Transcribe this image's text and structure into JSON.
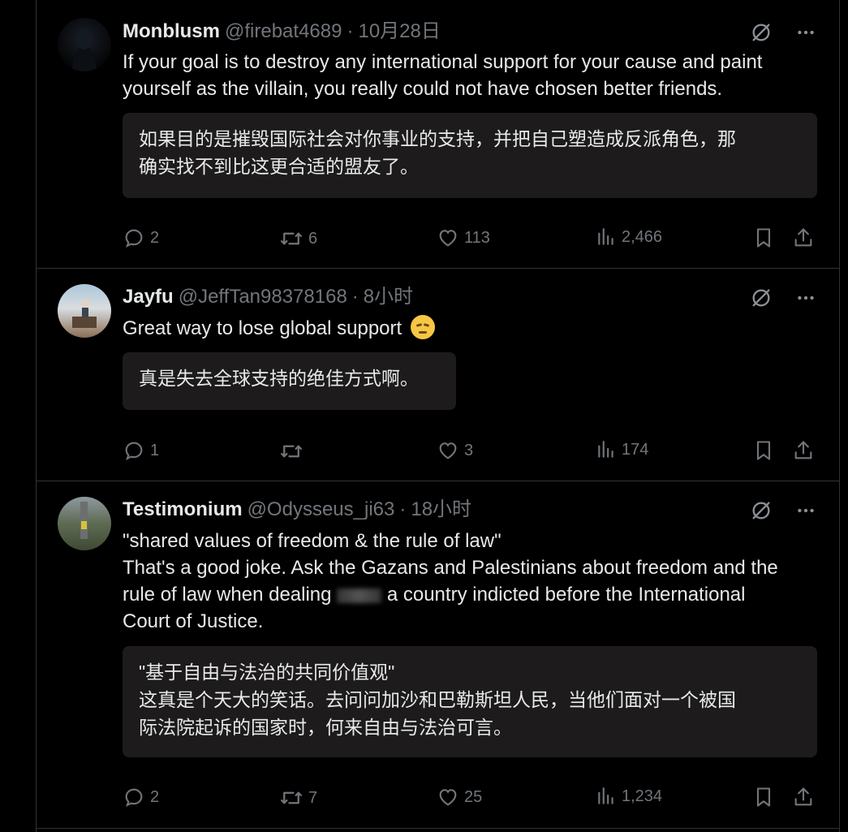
{
  "tweets": [
    {
      "name": "Monblusm",
      "handle": "@firebat4689",
      "time": "10月28日",
      "lines": [
        "If your goal is to destroy any international support for your cause and paint",
        "yourself as the villain, you really could not have chosen better friends."
      ],
      "translation_lines": [
        "如果目的是摧毁国际社会对你事业的支持，并把自己塑造成反派角色，那",
        "确实找不到比这更合适的盟友了。"
      ],
      "replies": "2",
      "reposts": "6",
      "likes": "113",
      "views": "2,466"
    },
    {
      "name": "Jayfu",
      "handle": "@JeffTan98378168",
      "time": "8小时",
      "lines": [
        "Great way to lose global support"
      ],
      "emoji": "disappointed-face",
      "translation_lines": [
        "真是失去全球支持的绝佳方式啊。"
      ],
      "replies": "1",
      "reposts": "",
      "likes": "3",
      "views": "174"
    },
    {
      "name": "Testimonium",
      "handle": "@Odysseus_ji63",
      "time": "18小时",
      "lines": [
        "\"shared values of freedom & the rule of law\"",
        "That's a good joke. Ask the Gazans and Palestinians about freedom and the",
        "rule of law when dealing",
        "a country indicted before the International",
        "Court of Justice."
      ],
      "translation_lines": [
        "\"基于自由与法治的共同价值观\"",
        "这真是个天大的笑话。去问问加沙和巴勒斯坦人民，当他们面对一个被国",
        "际法院起诉的国家时，何来自由与法治可言。"
      ],
      "replies": "2",
      "reposts": "7",
      "likes": "25",
      "views": "1,234"
    }
  ],
  "colors": {
    "background": "#000000",
    "text": "#e7e9ea",
    "muted": "#71767b",
    "border": "#2f3336",
    "translation_bg": "#1d1b1c"
  },
  "icons": [
    "grok-icon",
    "more-icon",
    "reply-icon",
    "repost-icon",
    "like-icon",
    "views-icon",
    "bookmark-icon",
    "share-icon"
  ]
}
